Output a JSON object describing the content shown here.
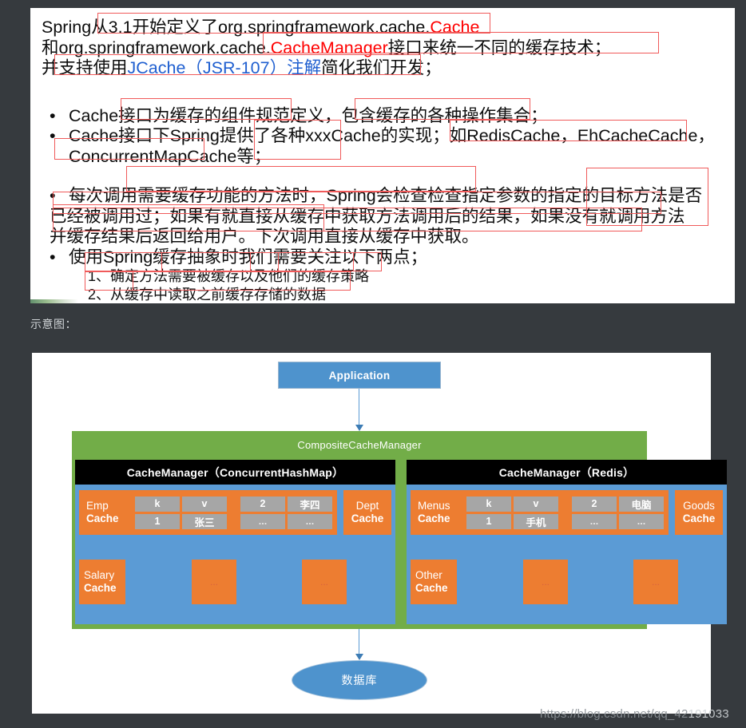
{
  "slide": {
    "paragraph": [
      {
        "segments": [
          {
            "t": "Spring从3.1开始定义了org.springframework.cache.",
            "c": "black"
          },
          {
            "t": "Cache",
            "c": "red"
          }
        ]
      },
      {
        "segments": [
          {
            "t": "和org.springframework.cache.",
            "c": "black"
          },
          {
            "t": "CacheManager",
            "c": "red"
          },
          {
            "t": "接口来统一不同的缓存技术；",
            "c": "black"
          }
        ]
      },
      {
        "segments": [
          {
            "t": "并支持使用",
            "c": "black"
          },
          {
            "t": "JCache（JSR-107）注解",
            "c": "blue"
          },
          {
            "t": "简化我们开发；",
            "c": "black"
          }
        ]
      }
    ],
    "bullets": [
      {
        "marker": "•",
        "text": "Cache接口为缓存的组件规范定义，包含缓存的各种操作集合；"
      },
      {
        "marker": "•",
        "text": "Cache接口下Spring提供了各种xxxCache的实现；如RedisCache，EhCacheCache，"
      },
      {
        "marker": "",
        "text": "ConcurrentMapCache等；"
      }
    ],
    "bullets2": [
      {
        "marker": "•",
        "text": "每次调用需要缓存功能的方法时，Spring会检查检查指定参数的指定的目标方法是否"
      },
      {
        "marker": "",
        "text": "已经被调用过；如果有就直接从缓存中获取方法调用后的结果，如果没有就调用方法"
      },
      {
        "marker": "",
        "text": "并缓存结果后返回给用户。下次调用直接从缓存中获取。"
      },
      {
        "marker": "•",
        "text": "使用Spring缓存抽象时我们需要关注以下两点；"
      }
    ],
    "numbered": [
      "1、确定方法需要被缓存以及他们的缓存策略",
      "2、从缓存中读取之前缓存存储的数据"
    ]
  },
  "section_label": "示意图：",
  "diagram": {
    "application": "Application",
    "composite": "CompositeCacheManager",
    "left_panel": {
      "header": "CacheManager（ConcurrentHashMap）",
      "primary_cache": {
        "line1": "Emp",
        "line2": "Cache"
      },
      "kv_table_a": [
        [
          "k",
          "v"
        ],
        [
          "1",
          "张三"
        ]
      ],
      "kv_table_b": [
        [
          "2",
          "李四"
        ],
        [
          "...",
          "..."
        ]
      ],
      "side_cache": {
        "line1": "Dept",
        "line2": "Cache"
      },
      "second_cache": {
        "line1": "Salary",
        "line2": "Cache"
      },
      "placeholders": [
        "...",
        "..."
      ]
    },
    "right_panel": {
      "header": "CacheManager（Redis）",
      "primary_cache": {
        "line1": "Menus",
        "line2": "Cache"
      },
      "kv_table_a": [
        [
          "k",
          "v"
        ],
        [
          "1",
          "手机"
        ]
      ],
      "kv_table_b": [
        [
          "2",
          "电脑"
        ],
        [
          "...",
          "..."
        ]
      ],
      "side_cache": {
        "line1": "Goods",
        "line2": "Cache"
      },
      "second_cache": {
        "line1": "Other",
        "line2": "Cache"
      },
      "placeholders": [
        "...",
        "..."
      ]
    },
    "database": "数据库"
  },
  "watermark": {
    "dim": "https://blog.csdn.net/qq_42",
    "bright": "191033"
  },
  "colors": {
    "page_background": "#363a3e",
    "card_background": "#ffffff",
    "annotation_red": "#f05a5a",
    "text_red": "#ff0000",
    "text_blue": "#1f5fd0",
    "green": "#72ad48",
    "blue": "#5b9bd5",
    "app_blue": "#4e93cd",
    "orange": "#ed7d31",
    "gray_cell": "#a6a6a6",
    "black_header": "#000000"
  }
}
